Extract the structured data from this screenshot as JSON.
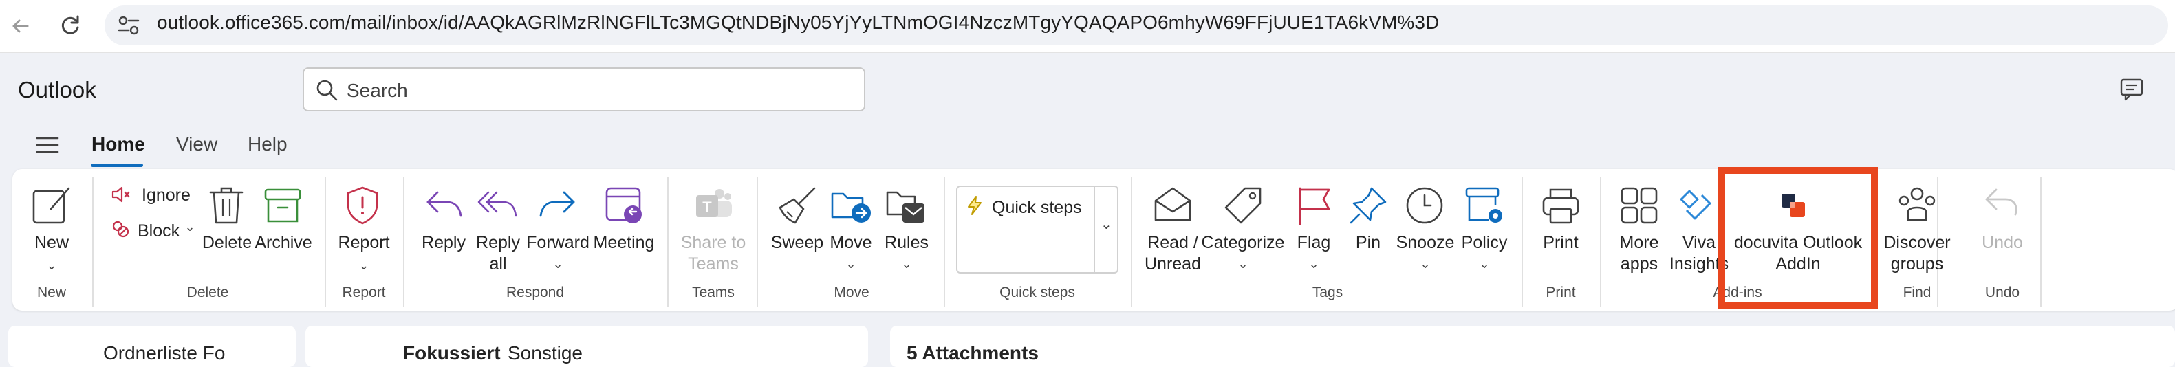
{
  "browser": {
    "url": "outlook.office365.com/mail/inbox/id/AAQkAGRlMzRlNGFlLTc3MGQtNDBjNy05YjYyLTNmOGI4NzczMTgyYQAQAPO6mhyW69FFjUUE1TA6kVM%3D"
  },
  "app": {
    "title": "Outlook",
    "search_placeholder": "Search"
  },
  "tabs": [
    {
      "label": "Home",
      "active": true
    },
    {
      "label": "View",
      "active": false
    },
    {
      "label": "Help",
      "active": false
    }
  ],
  "ribbon": {
    "new": {
      "label": "New",
      "group": "New"
    },
    "delete_group": {
      "ignore": "Ignore",
      "block": "Block",
      "delete": "Delete",
      "archive": "Archive",
      "group": "Delete"
    },
    "report": {
      "label": "Report",
      "group": "Report"
    },
    "respond": {
      "reply": "Reply",
      "reply_all_line1": "Reply",
      "reply_all_line2": "all",
      "forward": "Forward",
      "meeting": "Meeting",
      "group": "Respond"
    },
    "teams": {
      "line1": "Share to",
      "line2": "Teams",
      "group": "Teams"
    },
    "move_group": {
      "sweep": "Sweep",
      "move": "Move",
      "rules": "Rules",
      "group": "Move"
    },
    "quick_steps": {
      "label": "Quick steps",
      "group": "Quick steps"
    },
    "tags": {
      "read_line1": "Read /",
      "read_line2": "Unread",
      "categorize": "Categorize",
      "flag": "Flag",
      "pin": "Pin",
      "snooze": "Snooze",
      "policy": "Policy",
      "group": "Tags"
    },
    "print": {
      "label": "Print",
      "group": "Print"
    },
    "addins": {
      "more_line1": "More",
      "more_line2": "apps",
      "viva_line1": "Viva",
      "viva_line2": "Insights",
      "docuvita_line1": "docuvita Outlook",
      "docuvita_line2": "AddIn",
      "group": "Add-ins"
    },
    "find": {
      "line1": "Discover",
      "line2": "groups",
      "group": "Find"
    },
    "undo": {
      "label": "Undo",
      "group": "Undo"
    }
  },
  "panes": {
    "folder_text": "Ordnerliste Fo",
    "list_text_1": "Fokussiert",
    "list_text_2": "Sonstige",
    "reading_text": "5 Attachments"
  },
  "colors": {
    "accent": "#0f6cbd",
    "highlight": "#e8461e"
  }
}
